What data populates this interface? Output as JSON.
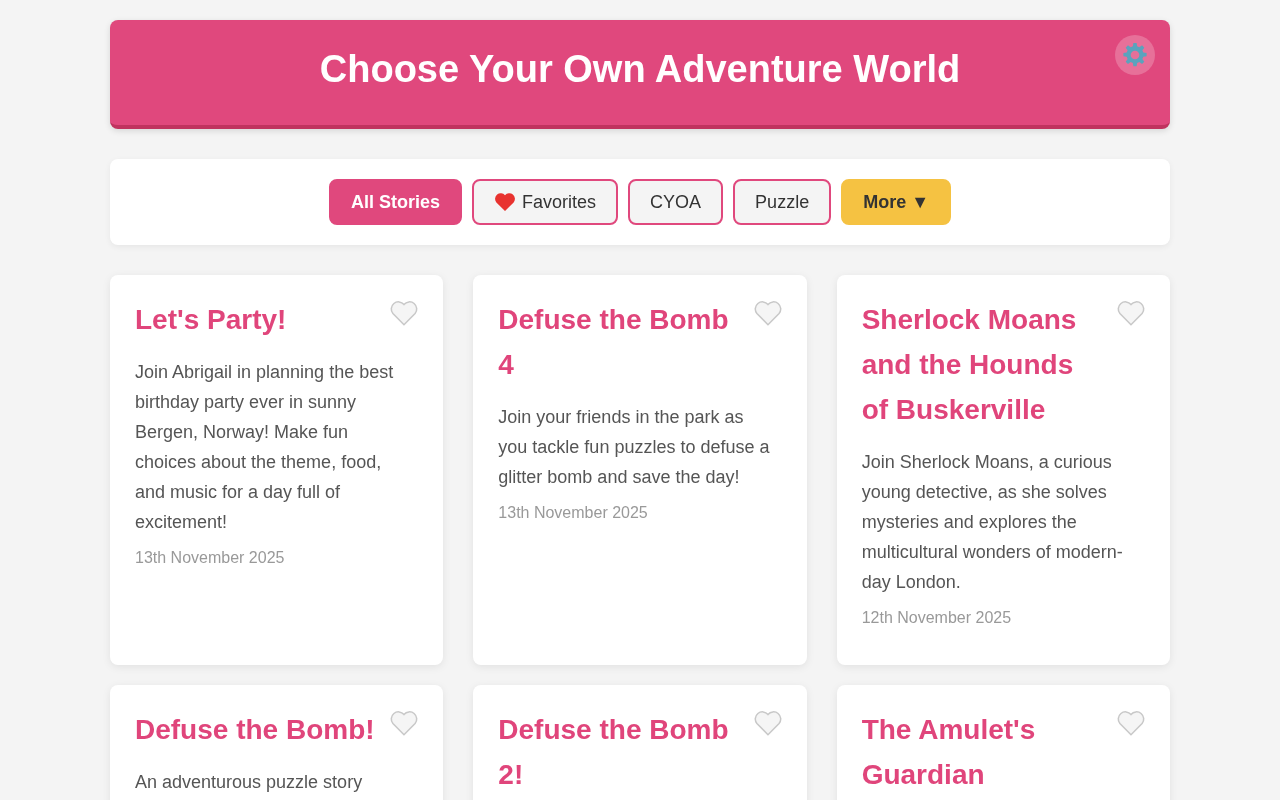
{
  "header": {
    "title": "Choose Your Own Adventure World"
  },
  "filters": [
    {
      "kind": "all",
      "label": "All Stories",
      "selected": true
    },
    {
      "kind": "favorites",
      "label": "Favorites",
      "selected": false
    },
    {
      "kind": "tag",
      "label": "CYOA",
      "selected": false
    },
    {
      "kind": "tag",
      "label": "Puzzle",
      "selected": false
    },
    {
      "kind": "more",
      "label": "More ▼",
      "selected": false
    }
  ],
  "stories": [
    {
      "title": "Let's Party!",
      "description": "Join Abrigail in planning the best birthday party ever in sunny Bergen, Norway! Make fun choices about the theme, food, and music for a day full of excitement!",
      "date": "13th November 2025",
      "favorite": false
    },
    {
      "title": "Defuse the Bomb 4",
      "description": "Join your friends in the park as you tackle fun puzzles to defuse a glitter bomb and save the day!",
      "date": "13th November 2025",
      "favorite": false
    },
    {
      "title": "Sherlock Moans and the Hounds of Buskerville",
      "description": "Join Sherlock Moans, a curious young detective, as she solves mysteries and explores the multicultural wonders of modern-day London.",
      "date": "12th November 2025",
      "favorite": false
    },
    {
      "title": "Defuse the Bomb!",
      "description": "An adventurous puzzle story",
      "favorite": false
    },
    {
      "title": "Defuse the Bomb 2!",
      "favorite": false
    },
    {
      "title": "The Amulet's Guardian",
      "favorite": false
    }
  ]
}
